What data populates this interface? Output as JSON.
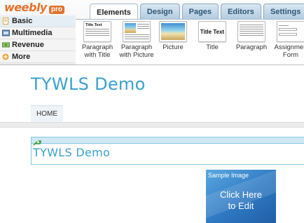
{
  "brand": {
    "name": "weebly",
    "tier": "pro",
    "color": "#e2722c"
  },
  "tabs": [
    {
      "label": "Elements",
      "active": true
    },
    {
      "label": "Design",
      "active": false
    },
    {
      "label": "Pages",
      "active": false
    },
    {
      "label": "Editors",
      "active": false
    },
    {
      "label": "Settings",
      "active": false
    }
  ],
  "categories": [
    {
      "label": "Basic",
      "icon": "document-icon"
    },
    {
      "label": "Multimedia",
      "icon": "film-icon"
    },
    {
      "label": "Revenue",
      "icon": "money-icon"
    },
    {
      "label": "More",
      "icon": "plus-icon"
    }
  ],
  "elements": [
    {
      "label_line1": "Paragraph",
      "label_line2": "with Title",
      "thumb_title": "Title Text"
    },
    {
      "label_line1": "Paragraph",
      "label_line2": "with Picture"
    },
    {
      "label_line1": "Picture",
      "label_line2": ""
    },
    {
      "label_line1": "Title",
      "label_line2": "",
      "thumb_title": "Title Text"
    },
    {
      "label_line1": "Paragraph",
      "label_line2": ""
    },
    {
      "label_line1": "Assignmen",
      "label_line2": "Form"
    }
  ],
  "page": {
    "site_title": "TYWLS Demo",
    "nav_items": [
      "HOME"
    ],
    "title_element_text": "TYWLS Demo",
    "sample_image": {
      "caption": "Sample Image",
      "cta_line1": "Click Here",
      "cta_line2": "to Edit"
    }
  },
  "colors": {
    "accent": "#3aa0cf",
    "tab": "#2d5575"
  }
}
